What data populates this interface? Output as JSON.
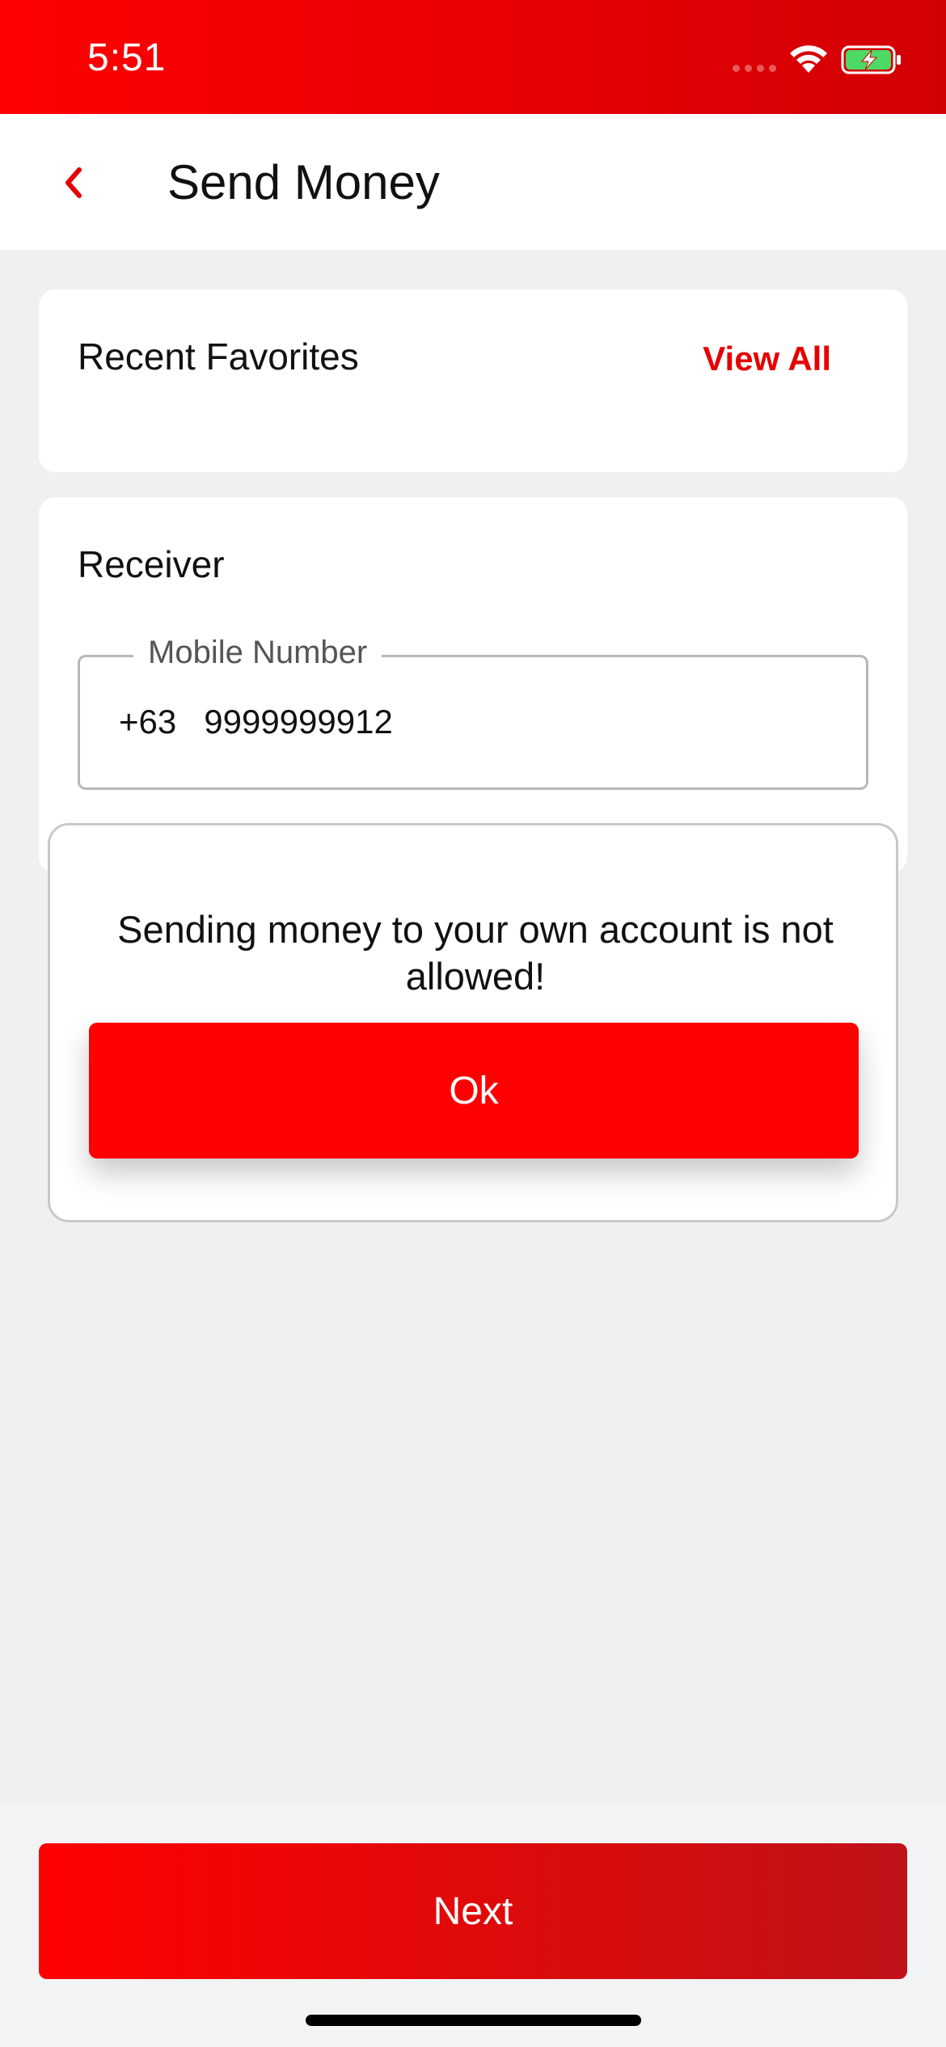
{
  "status_bar": {
    "time": "5:51"
  },
  "header": {
    "title": "Send Money",
    "back_icon": "chevron-left-icon"
  },
  "favorites": {
    "title": "Recent Favorites",
    "view_all_label": "View All"
  },
  "receiver": {
    "title": "Receiver",
    "mobile_label": "Mobile Number",
    "country_code": "+63",
    "mobile_value": "9999999912"
  },
  "alert": {
    "message": "Sending money to your own account is not allowed!",
    "ok_label": "Ok"
  },
  "footer": {
    "next_label": "Next"
  },
  "colors": {
    "accent": "#ff0000",
    "accent_dark": "#bf1218",
    "background": "#eff0f2",
    "link": "#e60000"
  }
}
